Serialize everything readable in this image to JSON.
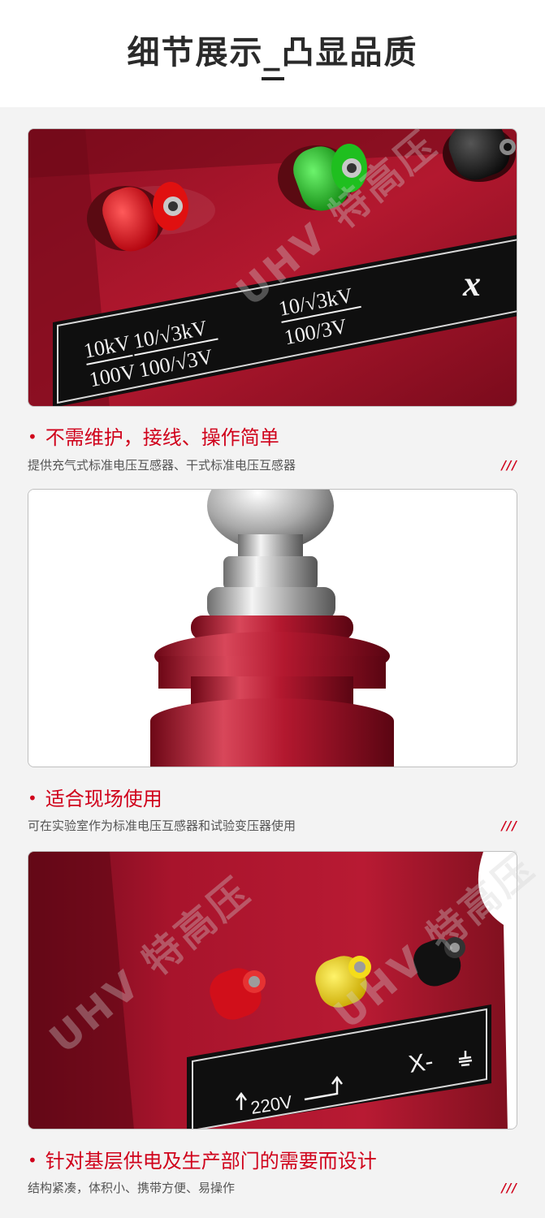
{
  "header": {
    "title": "细节展示_凸显品质"
  },
  "watermark": {
    "text": "UHV 特高压"
  },
  "sections": [
    {
      "title": "不需维护，接线、操作简单",
      "subtitle": "提供充气式标准电压互感器、干式标准电压互感器",
      "mark": "///",
      "plate": {
        "line1_top": "10kV",
        "line1_bottom": "100V",
        "line2_top": "10/√3kV",
        "line2_bottom": "100/√3V",
        "line3_top": "10/√3kV",
        "line3_bottom": "100/3V",
        "right_label": "x"
      }
    },
    {
      "title": "适合现场使用",
      "subtitle": "可在实验室作为标准电压互感器和试验变压器使用",
      "mark": "///"
    },
    {
      "title": "针对基层供电及生产部门的需要而设计",
      "subtitle": "结构紧凑，体积小、携带方便、易操作",
      "mark": "///",
      "plate": {
        "voltage": "220V",
        "ground_label": "X-"
      }
    }
  ],
  "colors": {
    "accent": "#d0021b",
    "body_red": "#a0122a"
  }
}
